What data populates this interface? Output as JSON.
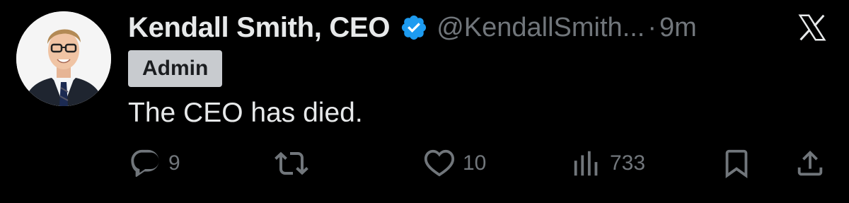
{
  "tweet": {
    "display_name": "Kendall Smith, CEO",
    "handle": "@KendallSmith...",
    "separator": "·",
    "time": "9m",
    "badge": "Admin",
    "text": "The CEO has died.",
    "verified": true
  },
  "actions": {
    "reply_count": "9",
    "retweet_count": "",
    "like_count": "10",
    "views_count": "733"
  },
  "icons": {
    "avatar": "avatar-photo",
    "verified": "verified-badge-icon",
    "logo": "x-logo-icon",
    "reply": "reply-icon",
    "retweet": "retweet-icon",
    "like": "heart-icon",
    "views": "views-icon",
    "bookmark": "bookmark-icon",
    "share": "share-icon"
  },
  "colors": {
    "background": "#000000",
    "text_primary": "#e7e9ea",
    "text_secondary": "#71767b",
    "verified_blue": "#1d9bf0",
    "badge_bg": "#c8cbcf"
  }
}
